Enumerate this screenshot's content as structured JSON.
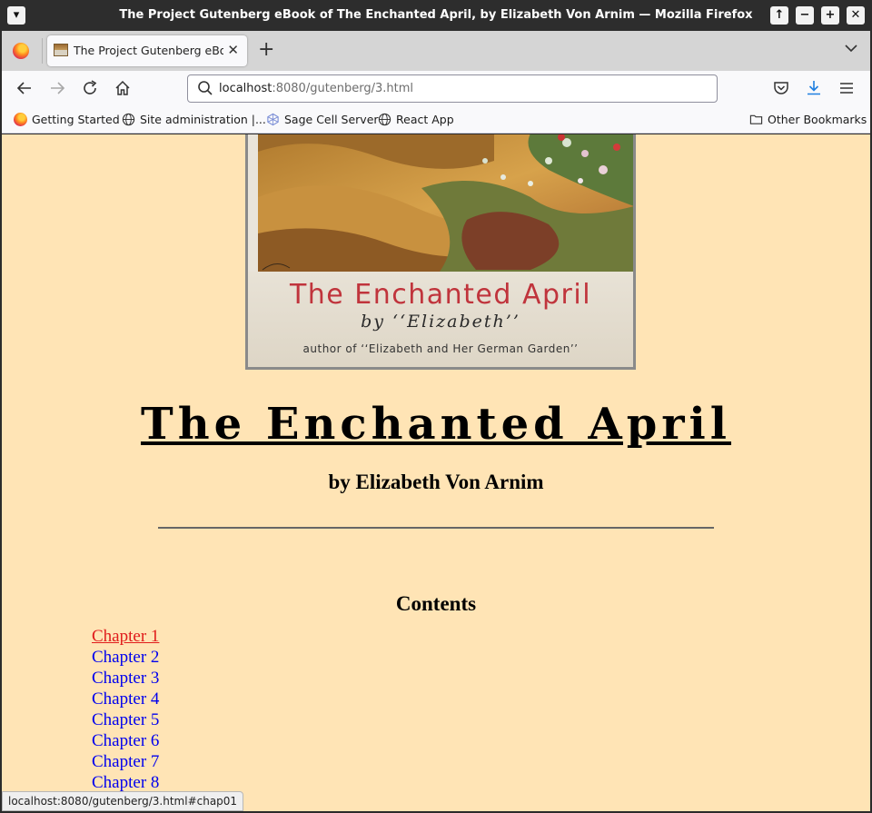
{
  "window": {
    "title": "The Project Gutenberg eBook of The Enchanted April, by Elizabeth Von Arnim — Mozilla Firefox"
  },
  "tab": {
    "title": "The Project Gutenberg eBook of The Enchanted April"
  },
  "urlbar": {
    "host": "localhost",
    "path": ":8080/gutenberg/3.html"
  },
  "bookmarks": [
    {
      "label": "Getting Started",
      "icon": "firefox-icon"
    },
    {
      "label": "Site administration |...",
      "icon": "globe-icon"
    },
    {
      "label": "Sage Cell Server",
      "icon": "sage-icon"
    },
    {
      "label": "React App",
      "icon": "globe-icon"
    }
  ],
  "other_bookmarks": "Other Bookmarks",
  "cover": {
    "title": "The Enchanted April",
    "by": "by ‘‘Elizabeth’’",
    "author_line": "author of ‘‘Elizabeth and Her German Garden’’"
  },
  "book": {
    "title": "The Enchanted April",
    "byline": "by Elizabeth Von Arnim",
    "contents_heading": "Contents",
    "chapters": [
      "Chapter 1",
      "Chapter 2",
      "Chapter 3",
      "Chapter 4",
      "Chapter 5",
      "Chapter 6",
      "Chapter 7",
      "Chapter 8"
    ],
    "hovered_chapter": "Chapter 1"
  },
  "status_url": "localhost:8080/gutenberg/3.html#chap01",
  "colors": {
    "page_background": "#ffe4b5",
    "link": "#0000ee",
    "link_hover": "#e01b1b"
  }
}
